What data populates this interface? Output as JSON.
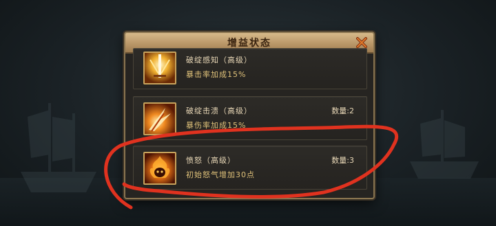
{
  "panel": {
    "title": "增益状态"
  },
  "buffs": [
    {
      "name": "破绽感知（高级）",
      "desc": "暴击率加成15%",
      "count": "",
      "icon": "sword-light-icon"
    },
    {
      "name": "破绽击溃（高级）",
      "desc": "暴伤率加成15%",
      "count": "数量:2",
      "icon": "flame-slash-icon"
    },
    {
      "name": "愤怒（高级）",
      "desc": "初始怒气增加30点",
      "count": "数量:3",
      "icon": "rage-flame-icon"
    }
  ],
  "colors": {
    "title_bar": "#c4a473",
    "panel_bg": "#262421",
    "desc_text": "#e0c27a",
    "annotation": "#e0321f"
  }
}
